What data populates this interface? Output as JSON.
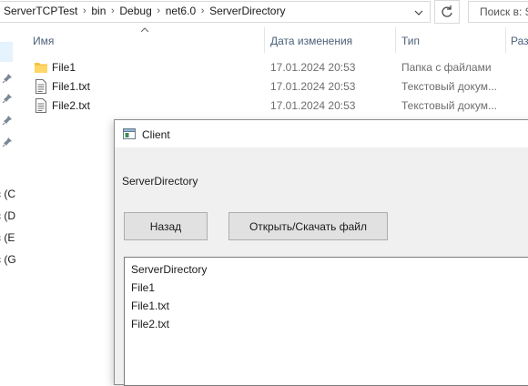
{
  "explorer": {
    "breadcrumbs": [
      "ServerTCPTest",
      "bin",
      "Debug",
      "net6.0",
      "ServerDirectory"
    ],
    "search_placeholder": "Поиск в: S",
    "columns": {
      "name": "Имя",
      "date": "Дата изменения",
      "type": "Тип",
      "size": "Раз"
    },
    "files": [
      {
        "name": "File1",
        "date": "17.01.2024 20:53",
        "type": "Папка с файлами",
        "icon": "folder-icon"
      },
      {
        "name": "File1.txt",
        "date": "17.01.2024 20:53",
        "type": "Текстовый докум...",
        "icon": "text-file-icon"
      },
      {
        "name": "File2.txt",
        "date": "17.01.2024 20:53",
        "type": "Текстовый докум...",
        "icon": "text-file-icon"
      }
    ],
    "nav_drives": [
      "с (С",
      "с (D",
      "с (E",
      "с (G"
    ]
  },
  "client": {
    "title": "Client",
    "current_path": "ServerDirectory",
    "back_label": "Назад",
    "open_label": "Открыть/Скачать файл",
    "list_items": [
      "ServerDirectory",
      "File1",
      "File1.txt",
      "File2.txt"
    ]
  },
  "colors": {
    "folder": "#f5c342",
    "column_header": "#4c607a",
    "button_face": "#e1e1e1",
    "window_bg": "#f0f0f0"
  }
}
